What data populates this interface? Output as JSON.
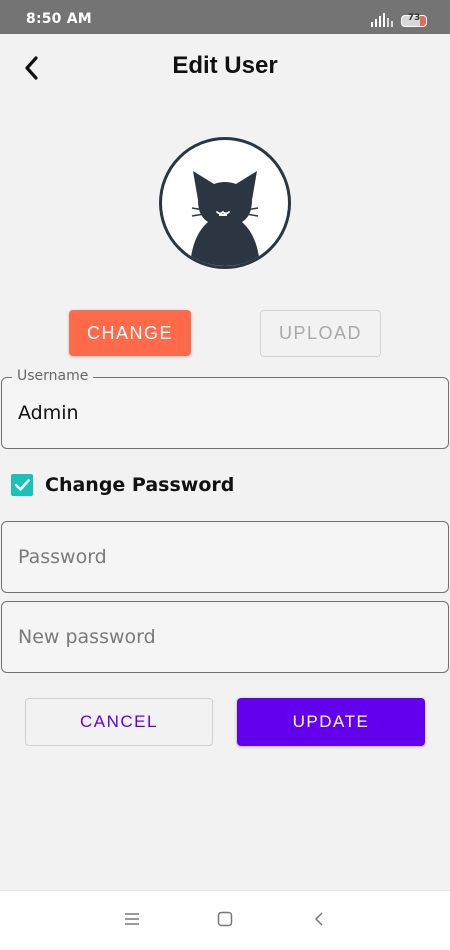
{
  "status_bar": {
    "time": "8:50 AM",
    "battery": "73",
    "icons": [
      "signal-icon",
      "battery-icon"
    ]
  },
  "header": {
    "title": "Edit User",
    "back_icon": "chevron-left-icon"
  },
  "avatar": {
    "icon": "cat-avatar-icon"
  },
  "photo_actions": {
    "change_label": "CHANGE",
    "upload_label": "UPLOAD"
  },
  "form": {
    "username_label": "Username",
    "username_value": "Admin",
    "change_password_label": "Change Password",
    "change_password_checked": true,
    "password_placeholder": "Password",
    "new_password_placeholder": "New password"
  },
  "actions": {
    "cancel_label": "CANCEL",
    "update_label": "UPDATE"
  },
  "colors": {
    "change_button": "#ff6b4a",
    "primary": "#6200ee",
    "checkbox": "#19c2b6",
    "status_bar": "#747474"
  },
  "nav_bar": {
    "icons": [
      "menu-icon",
      "home-icon",
      "back-icon"
    ]
  }
}
